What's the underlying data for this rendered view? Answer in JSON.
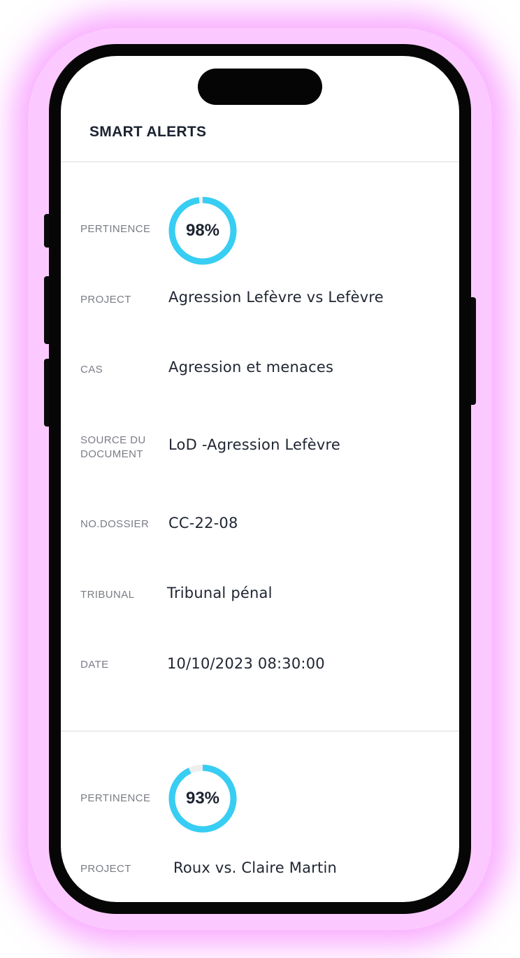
{
  "header": {
    "title": "SMART ALERTS"
  },
  "colors": {
    "accent": "#38cdf2",
    "track": "#eeeeee",
    "glow": "#f464ff"
  },
  "alerts": [
    {
      "pertinence": {
        "label": "PERTINENCE",
        "percent": 98,
        "text": "98%"
      },
      "project": {
        "label": "PROJECT",
        "value": "Agression Lefèvre vs Lefèvre"
      },
      "cas": {
        "label": "CAS",
        "value": "Agression et menaces"
      },
      "source": {
        "label_line1": "SOURCE DU",
        "label_line2": "DOCUMENT",
        "value": "LoD  -Agression Lefèvre"
      },
      "dossier": {
        "label": "NO.DOSSIER",
        "value": "CC-22-08"
      },
      "tribunal": {
        "label": "TRIBUNAL",
        "value": "Tribunal pénal"
      },
      "date": {
        "label": "DATE",
        "value": "10/10/2023  08:30:00"
      }
    },
    {
      "pertinence": {
        "label": "PERTINENCE",
        "percent": 93,
        "text": "93%"
      },
      "project": {
        "label": "PROJECT",
        "value": "Roux vs. Claire Martin"
      }
    }
  ]
}
